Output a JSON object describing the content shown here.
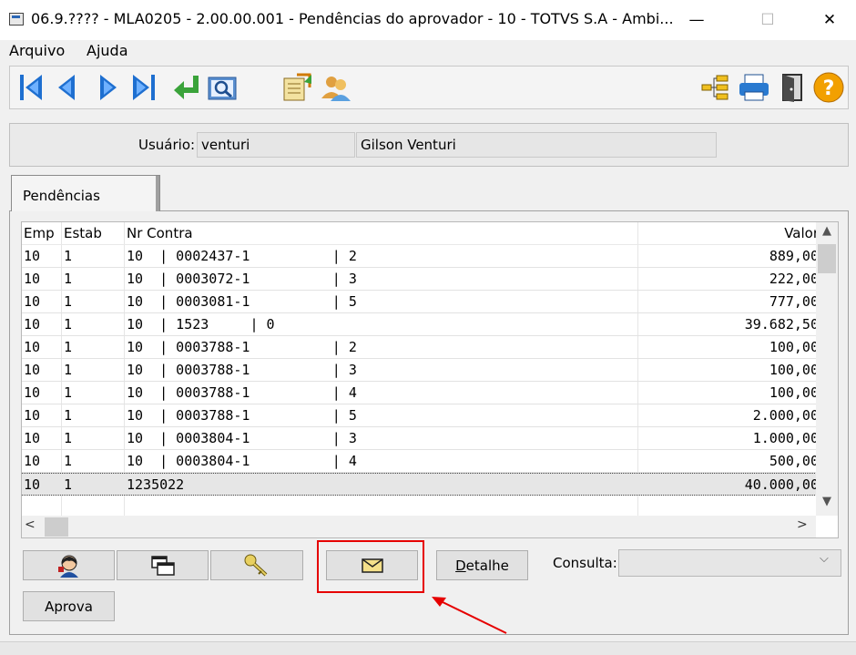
{
  "window": {
    "title": "06.9.???? - MLA0205 - 2.00.00.001 - Pendências do aprovador - 10 - TOTVS S.A - Ambi...",
    "minimize": "—",
    "maximize": "☐",
    "close": "✕"
  },
  "menu": {
    "items": [
      "Arquivo",
      "Ajuda"
    ]
  },
  "toolbar": {
    "icons": [
      "first-record-icon",
      "previous-record-icon",
      "next-record-icon",
      "last-record-icon",
      "go-to-icon",
      "search-icon",
      "approve-document-icon",
      "users-icon",
      "tree-structure-icon",
      "print-icon",
      "exit-door-icon",
      "help-icon"
    ]
  },
  "user": {
    "label": "Usuário:",
    "login": "venturi",
    "name": "Gilson Venturi"
  },
  "tab": {
    "label": "Pendências"
  },
  "grid": {
    "columns": [
      "Emp",
      "Estab",
      "Nr Contra",
      "Valor"
    ],
    "rows": [
      {
        "emp": "10",
        "estab": "1",
        "nr": "10  | 0002437-1          | 2",
        "valor": "889,00"
      },
      {
        "emp": "10",
        "estab": "1",
        "nr": "10  | 0003072-1          | 3",
        "valor": "222,00"
      },
      {
        "emp": "10",
        "estab": "1",
        "nr": "10  | 0003081-1          | 5",
        "valor": "777,00"
      },
      {
        "emp": "10",
        "estab": "1",
        "nr": "10  | 1523     | 0",
        "valor": "39.682,50"
      },
      {
        "emp": "10",
        "estab": "1",
        "nr": "10  | 0003788-1          | 2",
        "valor": "100,00"
      },
      {
        "emp": "10",
        "estab": "1",
        "nr": "10  | 0003788-1          | 3",
        "valor": "100,00"
      },
      {
        "emp": "10",
        "estab": "1",
        "nr": "10  | 0003788-1          | 4",
        "valor": "100,00"
      },
      {
        "emp": "10",
        "estab": "1",
        "nr": "10  | 0003788-1          | 5",
        "valor": "2.000,00"
      },
      {
        "emp": "10",
        "estab": "1",
        "nr": "10  | 0003804-1          | 3",
        "valor": "1.000,00"
      },
      {
        "emp": "10",
        "estab": "1",
        "nr": "10  | 0003804-1          | 4",
        "valor": "500,00"
      },
      {
        "emp": "10",
        "estab": "1",
        "nr": "1235022",
        "valor": "40.000,00"
      }
    ],
    "selected_row": 10
  },
  "buttons": {
    "detalhe_first": "D",
    "detalhe_rest": "etalhe",
    "aprova": "Aprova",
    "user_icon": "user-icon",
    "copy_icon": "copy-windows-icon",
    "key_icon": "key-icon",
    "mail_icon": "envelope-icon"
  },
  "consulta": {
    "label": "Consulta:",
    "value": ""
  },
  "colors": {
    "highlight": "#e60000",
    "toolbar_blue": "#1e6fd0",
    "accent_green": "#3aa33a"
  }
}
